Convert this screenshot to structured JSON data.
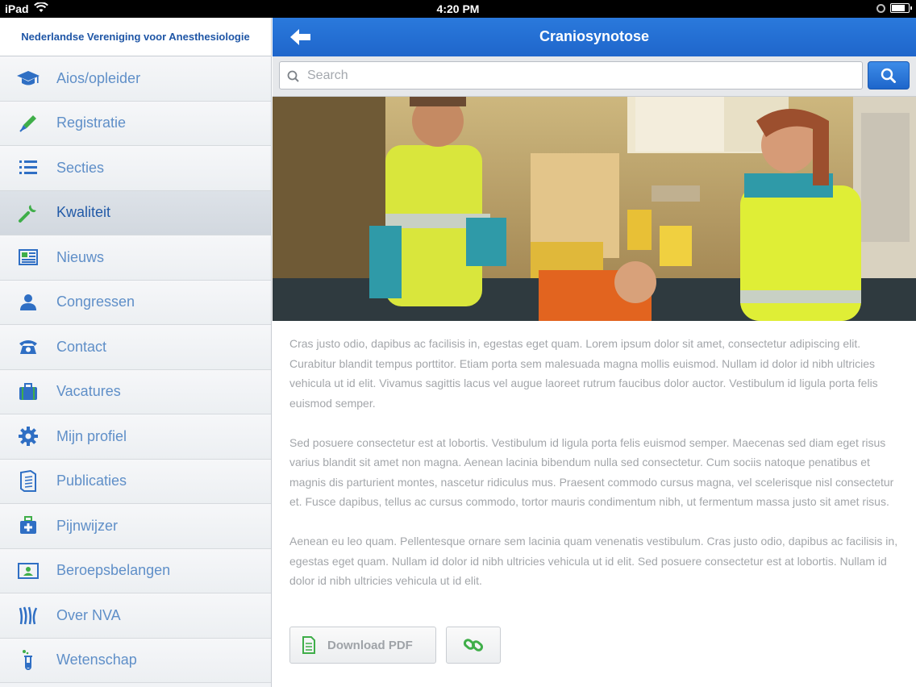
{
  "status_bar": {
    "carrier": "iPad",
    "time": "4:20 PM",
    "battery_level": 0.85
  },
  "sidebar": {
    "org_name": "Nederlandse Vereniging voor Anesthesiologie",
    "items": [
      {
        "label": "Aios/opleider",
        "icon": "graduation-cap-icon"
      },
      {
        "label": "Registratie",
        "icon": "pen-icon"
      },
      {
        "label": "Secties",
        "icon": "list-icon"
      },
      {
        "label": "Kwaliteit",
        "icon": "wrench-icon",
        "active": true
      },
      {
        "label": "Nieuws",
        "icon": "newspaper-icon"
      },
      {
        "label": "Congressen",
        "icon": "person-icon"
      },
      {
        "label": "Contact",
        "icon": "telephone-icon"
      },
      {
        "label": "Vacatures",
        "icon": "briefcase-icon"
      },
      {
        "label": "Mijn profiel",
        "icon": "gear-icon"
      },
      {
        "label": "Publicaties",
        "icon": "document-icon"
      },
      {
        "label": "Pijnwijzer",
        "icon": "medical-kit-icon"
      },
      {
        "label": "Beroepsbelangen",
        "icon": "id-card-icon"
      },
      {
        "label": "Over NVA",
        "icon": "nva-logo-icon"
      },
      {
        "label": "Wetenschap",
        "icon": "test-tube-icon"
      }
    ]
  },
  "main": {
    "title": "Craniosynotose",
    "search": {
      "placeholder": "Search",
      "value": ""
    },
    "hero_image": "paramedics-with-patient-photo",
    "paragraphs": [
      "Cras justo odio, dapibus ac facilisis in, egestas eget quam. Lorem ipsum dolor sit amet, consectetur adipiscing elit. Curabitur blandit tempus porttitor. Etiam porta sem malesuada magna mollis euismod. Nullam id dolor id nibh ultricies vehicula ut id elit. Vivamus sagittis lacus vel augue laoreet rutrum faucibus dolor auctor. Vestibulum id ligula porta felis euismod semper.",
      "Sed posuere consectetur est at lobortis. Vestibulum id ligula porta felis euismod semper. Maecenas sed diam eget risus varius blandit sit amet non magna. Aenean lacinia bibendum nulla sed consectetur. Cum sociis natoque penatibus et magnis dis parturient montes, nascetur ridiculus mus. Praesent commodo cursus magna, vel scelerisque nisl consectetur et. Fusce dapibus, tellus ac cursus commodo, tortor mauris condimentum nibh, ut fermentum massa justo sit amet risus.",
      "Aenean eu leo quam. Pellentesque ornare sem lacinia quam venenatis vestibulum. Cras justo odio, dapibus ac facilisis in, egestas eget quam. Nullam id dolor id nibh ultricies vehicula ut id elit. Sed posuere consectetur est at lobortis. Nullam id dolor id nibh ultricies vehicula ut id elit."
    ],
    "download_label": "Download PDF",
    "link_button_icon": "link-icon"
  },
  "colors": {
    "accent": "#1f66cb",
    "sidebar_label": "#5f8fc8",
    "icon_blue": "#2f6fc4",
    "icon_green": "#3fae49",
    "body_text": "#a3a6aa"
  }
}
